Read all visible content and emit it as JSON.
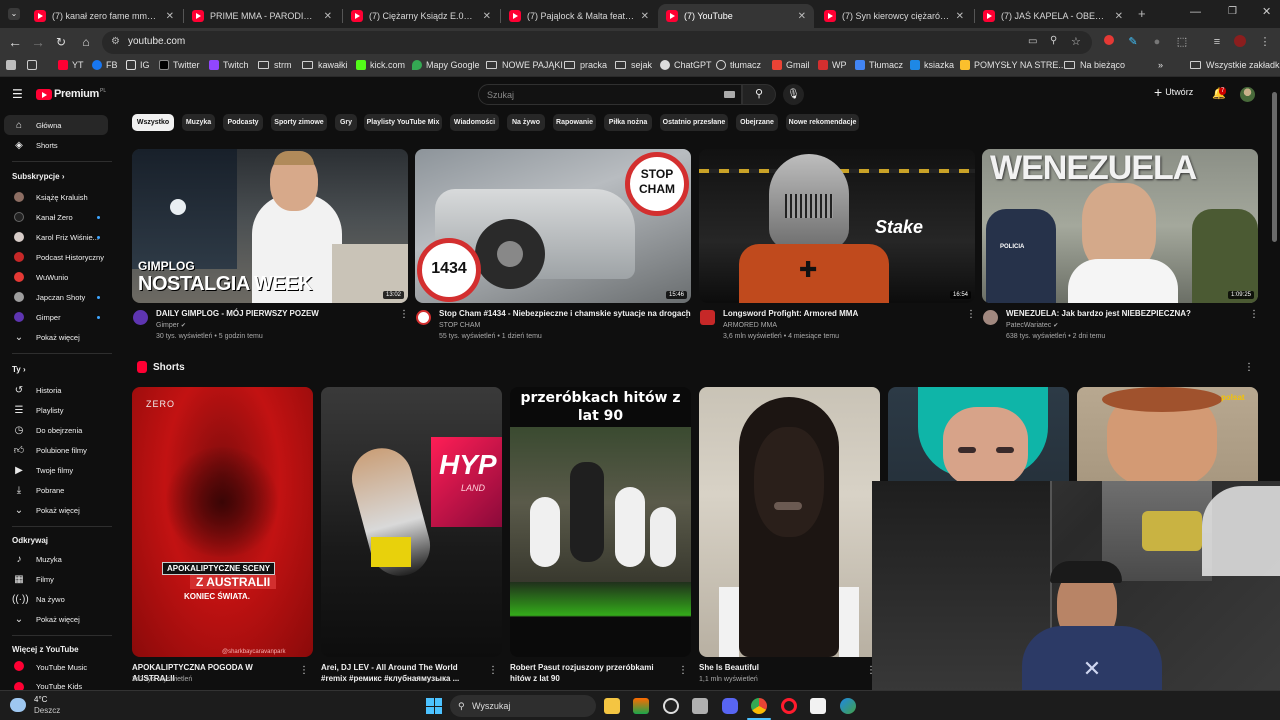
{
  "browser": {
    "tabs": [
      {
        "title": "(7) kanał zero fame mma - YouT"
      },
      {
        "title": "PRIME MMA - PARODIA HYMN"
      },
      {
        "title": "(7) Ciężarny Ksiądz E.01. Począt"
      },
      {
        "title": "(7) Pająlock & Malta feat. Alisha"
      },
      {
        "title": "(7) YouTube"
      },
      {
        "title": "(7) Syn kierowcy ciężarówki, kt"
      },
      {
        "title": "(7) JAŚ KAPELA - OBELGI I BLUZ"
      }
    ],
    "url": "youtube.com",
    "bookmarks": [
      "YT",
      "FB",
      "IG",
      "Twitter",
      "Twitch",
      "strm",
      "kawałki",
      "kick.com",
      "Mapy Google",
      "NOWE PAJĄKI",
      "pracka",
      "sejak",
      "ChatGPT",
      "tłumacz",
      "Gmail",
      "WP",
      "Tłumacz",
      "ksiazka",
      "POMYSŁY NA STRE...",
      "Na bieżąco"
    ],
    "all_bookmarks": "Wszystkie zakładki"
  },
  "header": {
    "brand": "Premium",
    "region": "PL",
    "search_placeholder": "Szukaj",
    "create_label": "Utwórz",
    "notifications": "7"
  },
  "sidebar": {
    "main": [
      "Główna",
      "Shorts"
    ],
    "subs_title": "Subskrypcje",
    "subs": [
      "Książę Kraluish",
      "Kanał Zero",
      "Karol Friz Wiśnie...",
      "Podcast Historyczny",
      "WuWunio",
      "Japczan Shoty",
      "Gimper"
    ],
    "subs_more": "Pokaż więcej",
    "you_title": "Ty",
    "you": [
      "Historia",
      "Playlisty",
      "Do obejrzenia",
      "Polubione filmy",
      "Twoje filmy",
      "Pobrane",
      "Pokaż więcej"
    ],
    "explore_title": "Odkrywaj",
    "explore": [
      "Muzyka",
      "Filmy",
      "Na żywo",
      "Pokaż więcej"
    ],
    "more_title": "Więcej z YouTube",
    "more": [
      "YouTube Music",
      "YouTube Kids"
    ]
  },
  "chips": [
    "Wszystko",
    "Muzyka",
    "Podcasty",
    "Sporty zimowe",
    "Gry",
    "Playlisty YouTube Mix",
    "Wiadomości",
    "Na żywo",
    "Rapowanie",
    "Piłka nożna",
    "Ostatnio przesłane",
    "Obejrzane",
    "Nowe rekomendacje"
  ],
  "videos": [
    {
      "title": "DAILY GIMPLOG - MÓJ PIERWSZY POZEW",
      "channel": "Gimper",
      "meta": "30 tys. wyświetleń • 5 godzin temu",
      "duration": "13:02",
      "thumb_text1": "GIMPLOG",
      "thumb_text2": "NOSTALGIA WEEK"
    },
    {
      "title": "Stop Cham #1434 - Niebezpieczne i chamskie sytuacje na drogach",
      "channel": "STOP CHAM",
      "meta": "55 tys. wyświetleń • 1 dzień temu",
      "duration": "15:46",
      "thumb_text1": "STOP CHAM",
      "thumb_text2": "1434"
    },
    {
      "title": "Longsword Profight: Armored MMA",
      "channel": "ARMORED MMA",
      "meta": "3,6 mln wyświetleń • 4 miesiące temu",
      "duration": "16:54",
      "thumb_text1": "Stake",
      "thumb_text2": ""
    },
    {
      "title": "WENEZUELA: Jak bardzo jest NIEBEZPIECZNA?",
      "channel": "PatecWariatec",
      "meta": "638 tys. wyświetleń • 2 dni temu",
      "duration": "1:09:25",
      "thumb_text1": "WENEZUELA",
      "thumb_text2": "POLICIA"
    }
  ],
  "shorts": {
    "title": "Shorts",
    "items": [
      {
        "title": "APOKALIPTYCZNA POGODA W AUSTRALII",
        "views": "243 tys. wyświetleń",
        "overlay1": "APOKALIPTYCZNE SCENY",
        "overlay2": "Z AUSTRALII",
        "overlay3": "KONIEC ŚWIATA.",
        "watermark": "@sharkbaycaravanpark",
        "logo": "ZERO"
      },
      {
        "title": "Arei, DJ LEV - All Around The World #remix #ремикс #клубнаямузыка ...",
        "views": "",
        "overlay1": "HYP",
        "overlay2": "LAND",
        "overlay3": "",
        "watermark": "",
        "logo": ""
      },
      {
        "title": "Robert Pasut rozjuszony przeróbkami hitów z lat 90",
        "views": "",
        "overlay1": "przeróbkach hitów z lat 90",
        "overlay2": "",
        "overlay3": "",
        "watermark": "",
        "logo": ""
      },
      {
        "title": "She Is Beautiful",
        "views": "1,1 mln wyświetleń",
        "overlay1": "",
        "overlay2": "",
        "overlay3": "",
        "watermark": "",
        "logo": ""
      },
      {
        "title": "",
        "views": "",
        "overlay1": "",
        "overlay2": "",
        "overlay3": "",
        "watermark": "",
        "logo": ""
      },
      {
        "title": "",
        "views": "",
        "overlay1": "",
        "overlay2": "",
        "overlay3": "",
        "watermark": "",
        "logo": "polsat"
      }
    ]
  },
  "taskbar": {
    "temp": "4°C",
    "weather": "Deszcz",
    "search": "Wyszukaj"
  },
  "colors": {
    "accent": "#ff0033",
    "bg": "#0f0f0f",
    "chip": "#272727"
  }
}
